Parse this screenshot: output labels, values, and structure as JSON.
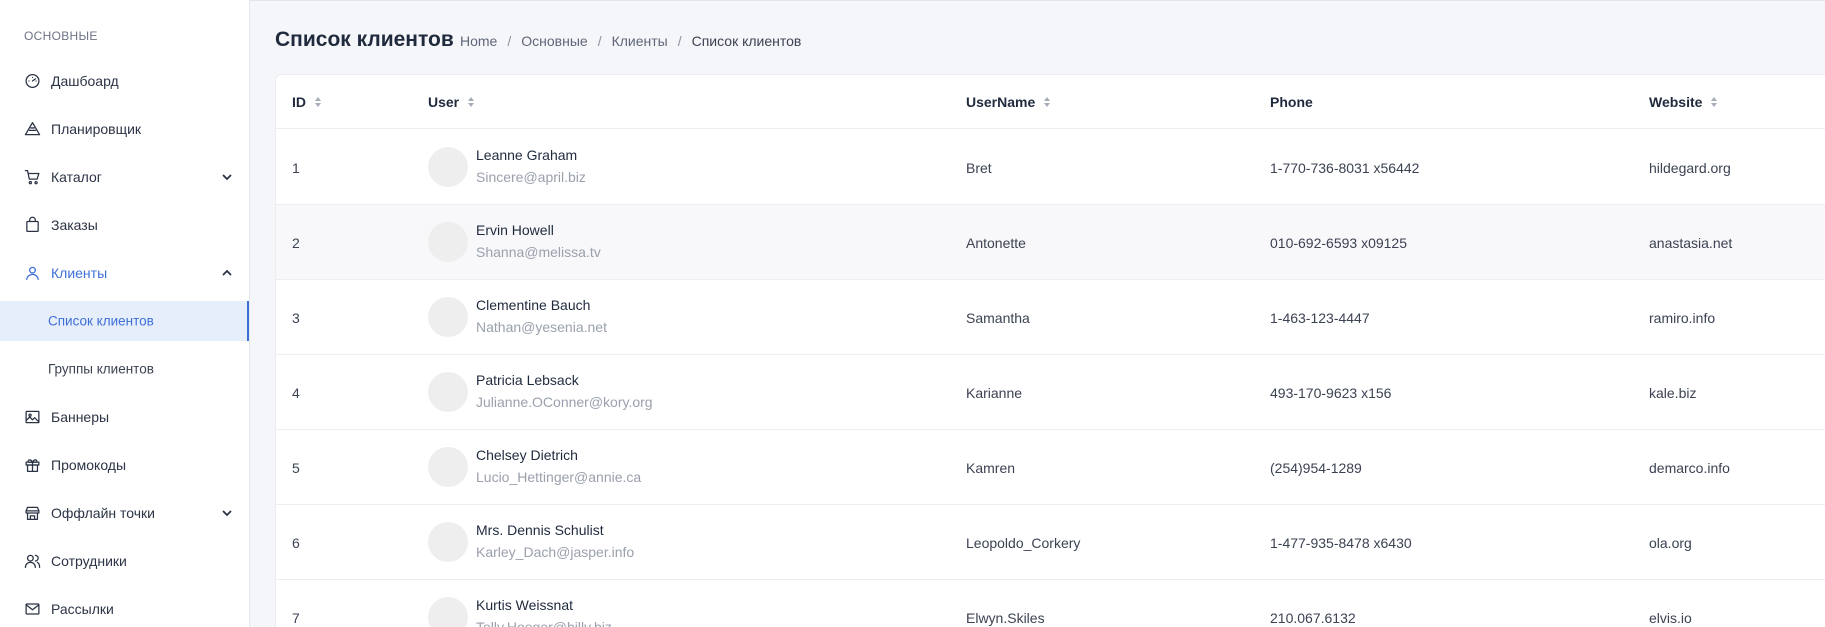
{
  "sidebar": {
    "section_title": "ОСНОВНЫЕ",
    "items": [
      {
        "label": "Дашбоард",
        "icon": "dashboard-gauge-icon"
      },
      {
        "label": "Планировщик",
        "icon": "planner-icon"
      },
      {
        "label": "Каталог",
        "icon": "cart-icon"
      },
      {
        "label": "Заказы",
        "icon": "shopping-bag-icon"
      },
      {
        "label": "Клиенты",
        "icon": "user-icon"
      },
      {
        "label": "Баннеры",
        "icon": "image-icon"
      },
      {
        "label": "Промокоды",
        "icon": "gift-icon"
      },
      {
        "label": "Оффлайн точки",
        "icon": "store-icon"
      },
      {
        "label": "Сотрудники",
        "icon": "users-icon"
      },
      {
        "label": "Рассылки",
        "icon": "mail-icon"
      }
    ],
    "clients_sub": [
      {
        "label": "Список клиентов"
      },
      {
        "label": "Группы клиентов"
      }
    ],
    "accent": "#3d6fd8"
  },
  "header": {
    "title": "Список клиентов",
    "breadcrumb": [
      "Home",
      "Основные",
      "Клиенты",
      "Список клиентов"
    ],
    "separator": "/"
  },
  "table": {
    "columns": {
      "id": "ID",
      "user": "User",
      "username": "UserName",
      "phone": "Phone",
      "website": "Website"
    },
    "rows": [
      {
        "id": "1",
        "name": "Leanne Graham",
        "email": "Sincere@april.biz",
        "username": "Bret",
        "phone": "1-770-736-8031 x56442",
        "website": "hildegard.org"
      },
      {
        "id": "2",
        "name": "Ervin Howell",
        "email": "Shanna@melissa.tv",
        "username": "Antonette",
        "phone": "010-692-6593 x09125",
        "website": "anastasia.net"
      },
      {
        "id": "3",
        "name": "Clementine Bauch",
        "email": "Nathan@yesenia.net",
        "username": "Samantha",
        "phone": "1-463-123-4447",
        "website": "ramiro.info"
      },
      {
        "id": "4",
        "name": "Patricia Lebsack",
        "email": "Julianne.OConner@kory.org",
        "username": "Karianne",
        "phone": "493-170-9623 x156",
        "website": "kale.biz"
      },
      {
        "id": "5",
        "name": "Chelsey Dietrich",
        "email": "Lucio_Hettinger@annie.ca",
        "username": "Kamren",
        "phone": "(254)954-1289",
        "website": "demarco.info"
      },
      {
        "id": "6",
        "name": "Mrs. Dennis Schulist",
        "email": "Karley_Dach@jasper.info",
        "username": "Leopoldo_Corkery",
        "phone": "1-477-935-8478 x6430",
        "website": "ola.org"
      },
      {
        "id": "7",
        "name": "Kurtis Weissnat",
        "email": "Telly.Hoeger@billy.biz",
        "username": "Elwyn.Skiles",
        "phone": "210.067.6132",
        "website": "elvis.io"
      }
    ]
  }
}
